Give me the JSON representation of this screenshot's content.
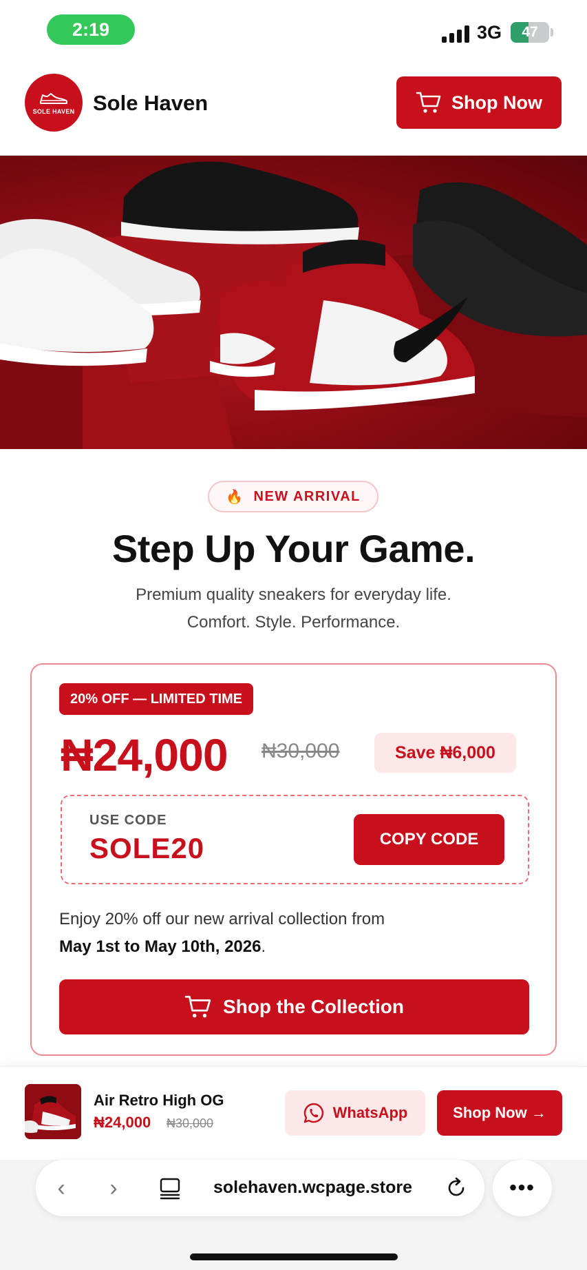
{
  "status_bar": {
    "time": "2:19",
    "network": "3G",
    "battery": "47",
    "battery_level": 0.47
  },
  "header": {
    "logo_text": "SOLE HAVEN",
    "brand": "Sole Haven",
    "shop_button": "Shop Now"
  },
  "hero": {
    "badge_icon": "🔥",
    "badge": "NEW ARRIVAL",
    "headline": "Step Up Your Game.",
    "sub_line1": "Premium quality sneakers for everyday life.",
    "sub_line2": "Comfort. Style. Performance."
  },
  "offer": {
    "chip": "20% OFF — LIMITED TIME",
    "price": "₦24,000",
    "old_price": "₦30,000",
    "save": "Save ₦6,000",
    "use_code_label": "USE CODE",
    "code": "SOLE20",
    "copy_button": "COPY CODE",
    "desc_line1": "Enjoy 20% off our new arrival collection from",
    "desc_date": "May 1st to May 10th, 2026",
    "desc_end": ".",
    "cta": "Shop the Collection"
  },
  "sticky_bar": {
    "product_name": "Air Retro High OG",
    "price": "₦24,000",
    "old_price": "₦30,000",
    "whatsapp": "WhatsApp",
    "shop_now": "Shop Now →"
  },
  "browser": {
    "url": "solehaven.wcpage.store",
    "more": "•••"
  },
  "colors": {
    "brand_red": "#c8101c",
    "status_green": "#34c759"
  },
  "icons": [
    "cart-icon",
    "shoe-icon",
    "whatsapp-icon",
    "back-icon",
    "forward-icon",
    "tabs-icon",
    "reload-icon",
    "more-icon"
  ]
}
